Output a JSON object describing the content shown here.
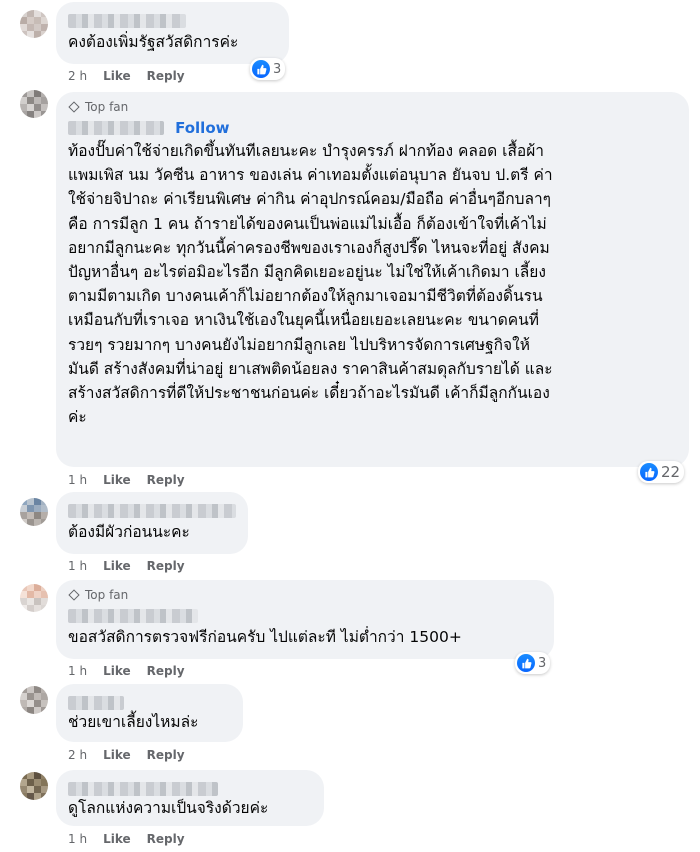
{
  "comments": [
    {
      "text": "คงต้องเพิ่มรัฐสวัสดิการค่ะ",
      "time": "2 h",
      "like_label": "Like",
      "reply_label": "Reply",
      "reaction_count": "3"
    },
    {
      "badge": "Top fan",
      "follow_label": "Follow",
      "text": "ท้องปั๊บค่าใช้จ่ายเกิดขึ้นทันทีเลยนะคะ บำรุงครรภ์ ฝากท้อง คลอด เสื้อผ้า\nแพมเพิส นม วัคซีน อาหาร ของเล่น ค่าเทอมตั้งแต่อนุบาล ยันจบ ป.ตรี ค่า\nใช้จ่ายจิปาถะ ค่าเรียนพิเศษ ค่ากิน ค่าอุปกรณ์คอม/มือถือ ค่าอื่นๆอีกบลาๆ\nคือ การมีลูก 1 คน ถ้ารายได้ของคนเป็นพ่อแม่ไม่เอื้อ ก็ต้องเข้าใจที่เค้าไม่\nอยากมีลูกนะคะ ทุกวันนี้ค่าครองชีพของเราเองก็สูงปรี๊ด ไหนจะที่อยู่ สังคม\nปัญหาอื่นๆ อะไรต่อมิอะไรอีก มีลูกคิดเยอะอยู่นะ ไม่ใช่ให้เค้าเกิดมา เลี้ยง\nตามมีตามเกิด บางคนเค้าก็ไม่อยากต้องให้ลูกมาเจอมามีชีวิตที่ต้องดิ้นรน\nเหมือนกับที่เราเจอ หาเงินใช้เองในยุคนี้เหนื่อยเยอะเลยนะคะ ขนาดคนที่\nรวยๆ รวยมากๆ บางคนยังไม่อยากมีลูกเลย ไปบริหารจัดการเศษฐกิจให้\nมันดี สร้างสังคมที่น่าอยู่ ยาเสพติดน้อยลง ราคาสินค้าสมดุลกับรายได้ และ\nสร้างสวัสดิการที่ดีให้ประชาชนก่อนค่ะ เดี๋ยวถ้าอะไรมันดี เค้าก็มีลูกกันเอง\nค่ะ",
      "time": "1 h",
      "like_label": "Like",
      "reply_label": "Reply",
      "reaction_count": "22"
    },
    {
      "text": "ต้องมีผัวก่อนนะคะ",
      "time": "1 h",
      "like_label": "Like",
      "reply_label": "Reply"
    },
    {
      "badge": "Top fan",
      "text": "ขอสวัสดิการตรวจฟรีก่อนครับ ไปแต่ละที ไม่ต่ำกว่า 1500+",
      "time": "1 h",
      "like_label": "Like",
      "reply_label": "Reply",
      "reaction_count": "3"
    },
    {
      "text": "ช่วยเขาเลี้ยงไหมล่ะ",
      "time": "2 h",
      "like_label": "Like",
      "reply_label": "Reply"
    },
    {
      "text": "ดูโลกแห่งความเป็นจริงด้วยค่ะ",
      "time": "1 h",
      "like_label": "Like",
      "reply_label": "Reply"
    }
  ],
  "colors": {
    "bubble": "#f0f2f5",
    "link_blue": "#216fdb",
    "like_blue": "#0866ff",
    "meta_gray": "#65676b"
  },
  "icons": {
    "reaction": "like-thumb-icon",
    "badge": "diamond-icon"
  }
}
